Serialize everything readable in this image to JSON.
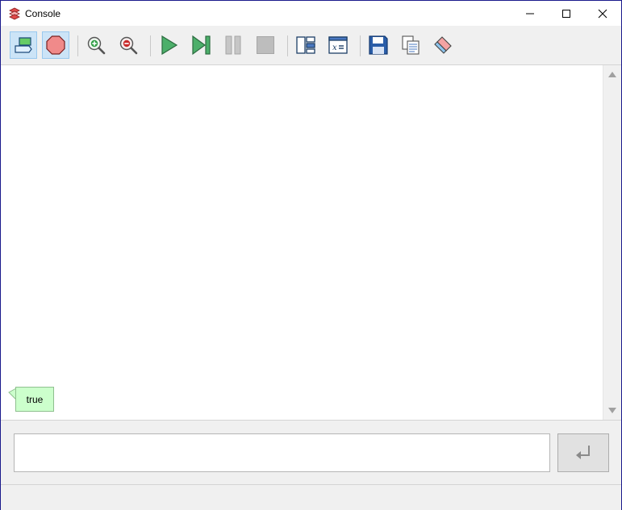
{
  "window": {
    "title": "Console",
    "icon": "console-app-icon"
  },
  "title_controls": {
    "minimize_icon": "minimize-icon",
    "maximize_icon": "maximize-icon",
    "close_icon": "close-icon"
  },
  "toolbar": {
    "buttons": [
      {
        "icon": "breakpoint-flag-icon",
        "active": true
      },
      {
        "icon": "stop-sign-icon",
        "active": true
      },
      {
        "icon": "zoom-in-icon",
        "active": false
      },
      {
        "icon": "zoom-out-icon",
        "active": false
      },
      {
        "icon": "play-icon",
        "active": false
      },
      {
        "icon": "step-icon",
        "active": false
      },
      {
        "icon": "pause-icon",
        "active": false,
        "disabled": true
      },
      {
        "icon": "stop-icon",
        "active": false,
        "disabled": true
      },
      {
        "icon": "layout-panels-icon",
        "active": false
      },
      {
        "icon": "variables-icon",
        "active": false
      },
      {
        "icon": "save-icon",
        "active": false
      },
      {
        "icon": "copy-icon",
        "active": false
      },
      {
        "icon": "eraser-icon",
        "active": false
      }
    ],
    "colors": {
      "active_bg": "#cce4f7",
      "active_border": "#99c9ef"
    }
  },
  "output": {
    "messages": [
      {
        "text": "true",
        "bg_color": "#ccffcc"
      }
    ]
  },
  "input": {
    "value": "",
    "placeholder": ""
  },
  "enter_button": {
    "icon": "enter-return-icon"
  }
}
